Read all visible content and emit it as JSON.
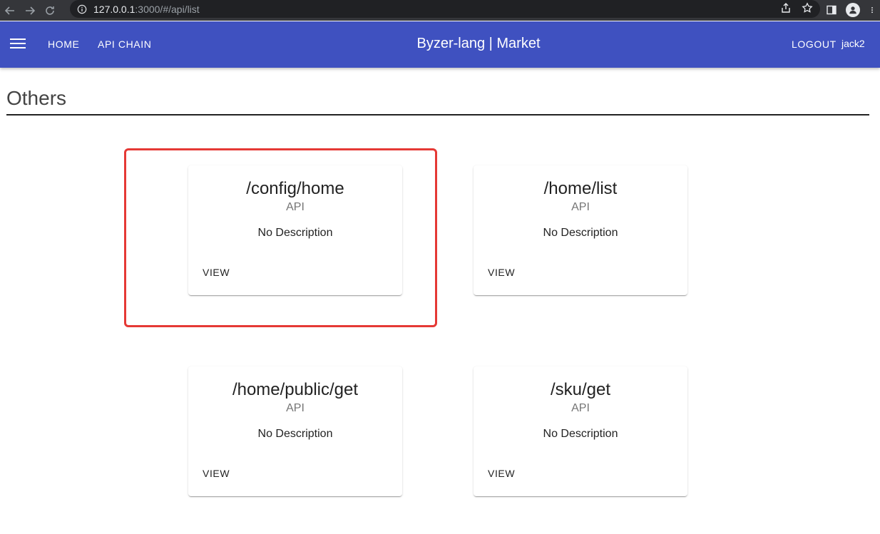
{
  "browser": {
    "url_host": "127.0.0.1",
    "url_path": ":3000/#/api/list"
  },
  "app_bar": {
    "home_label": "HOME",
    "api_chain_label": "API CHAIN",
    "title": "Byzer-lang | Market",
    "logout_label": "LOGOUT",
    "username": "jack2",
    "color": "#3f51c0"
  },
  "section": {
    "title": "Others"
  },
  "highlight_color": "#e53935",
  "cards": [
    {
      "title": "/config/home",
      "type": "API",
      "description": "No Description",
      "action": "VIEW"
    },
    {
      "title": "/home/list",
      "type": "API",
      "description": "No Description",
      "action": "VIEW"
    },
    {
      "title": "/home/public/get",
      "type": "API",
      "description": "No Description",
      "action": "VIEW"
    },
    {
      "title": "/sku/get",
      "type": "API",
      "description": "No Description",
      "action": "VIEW"
    }
  ]
}
